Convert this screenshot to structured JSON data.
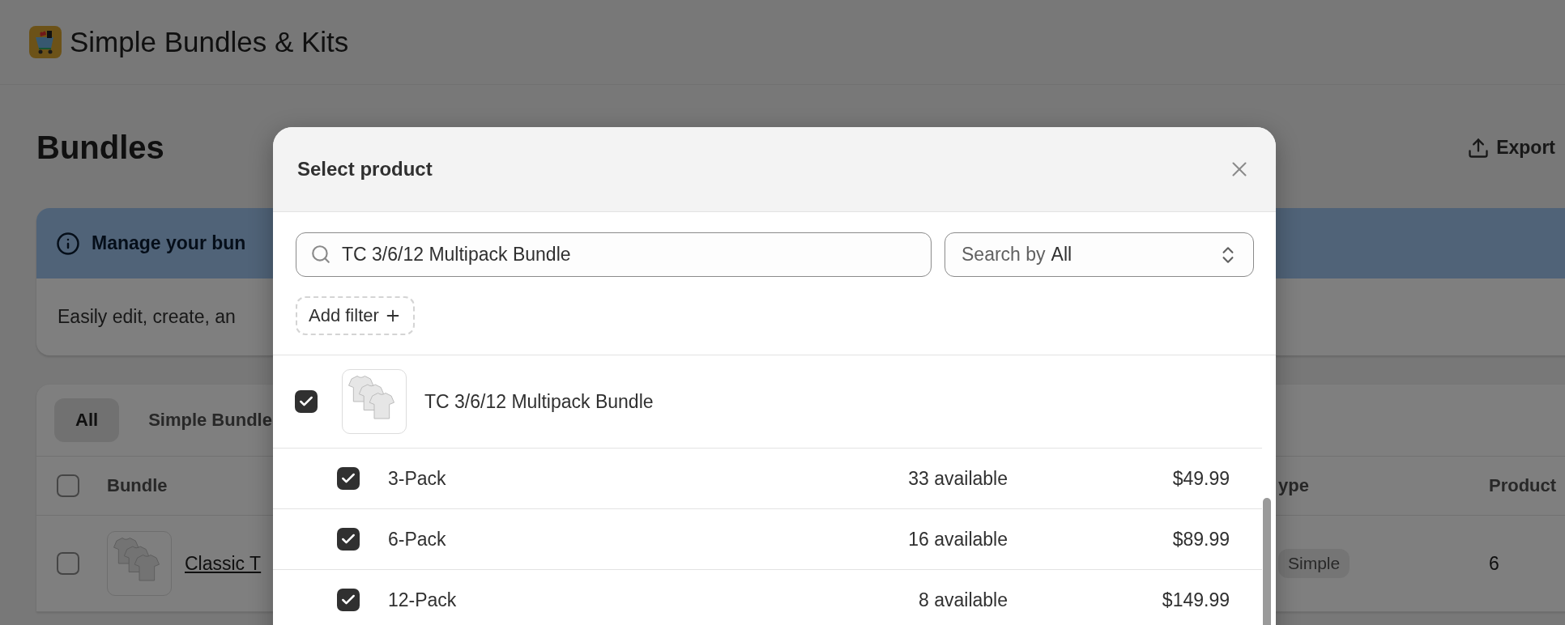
{
  "app": {
    "title": "Simple Bundles & Kits"
  },
  "page": {
    "title": "Bundles",
    "export_label": "Export"
  },
  "banner": {
    "title": "Manage your bun",
    "text": "Easily edit, create, an"
  },
  "tabs": [
    {
      "label": "All",
      "selected": true
    },
    {
      "label": "Simple Bundle",
      "selected": false
    }
  ],
  "table": {
    "select_all_checked": false,
    "columns": [
      "Bundle",
      "ype",
      "Product"
    ],
    "rows": [
      {
        "checked": false,
        "name": "Classic T",
        "type": "Simple",
        "products": "6"
      }
    ]
  },
  "modal": {
    "title": "Select product",
    "search": {
      "value": "TC 3/6/12 Multipack Bundle"
    },
    "search_by": {
      "label": "Search by",
      "value": "All"
    },
    "add_filter": "Add filter",
    "product": {
      "name": "TC 3/6/12 Multipack Bundle",
      "checked": true,
      "variants": [
        {
          "name": "3-Pack",
          "checked": true,
          "available": "33 available",
          "price": "$49.99"
        },
        {
          "name": "6-Pack",
          "checked": true,
          "available": "16 available",
          "price": "$89.99"
        },
        {
          "name": "12-Pack",
          "checked": true,
          "available": "8 available",
          "price": "$149.99"
        }
      ]
    }
  }
}
